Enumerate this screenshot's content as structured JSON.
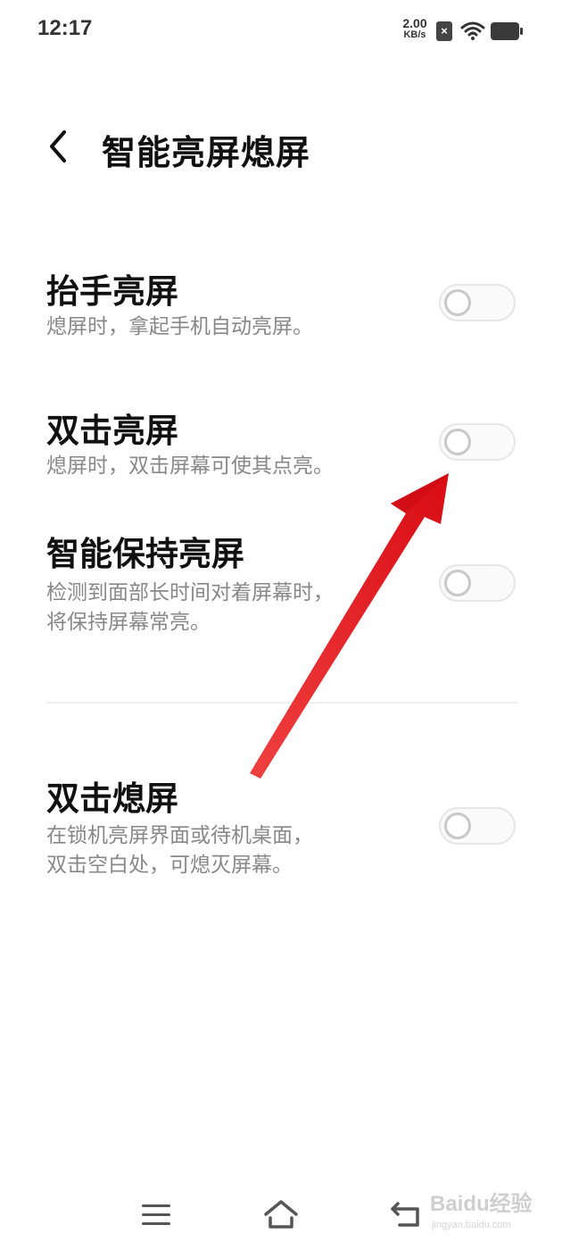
{
  "status_bar": {
    "time": "12:17",
    "net_speed_value": "2.00",
    "net_speed_unit": "KB/s",
    "icons": [
      "sim-off-icon",
      "wifi-icon",
      "battery-icon"
    ]
  },
  "header": {
    "back_icon": "chevron-left-icon",
    "title": "智能亮屏熄屏"
  },
  "settings": [
    {
      "title": "抬手亮屏",
      "desc": "熄屏时，拿起手机自动亮屏。",
      "enabled": false
    },
    {
      "title": "双击亮屏",
      "desc": "熄屏时，双击屏幕可使其点亮。",
      "enabled": false
    },
    {
      "title": "智能保持亮屏",
      "desc_lines": [
        "检测到面部长时间对着屏幕时，",
        "将保持屏幕常亮。"
      ],
      "enabled": false
    },
    {
      "title": "双击熄屏",
      "desc_lines": [
        "在锁机亮屏界面或待机桌面，",
        "双击空白处，可熄灭屏幕。"
      ],
      "enabled": false
    }
  ],
  "nav_bar": {
    "icons": [
      "menu-icon",
      "home-icon",
      "back-icon"
    ]
  },
  "watermark": {
    "text": "Baidu经验",
    "url": "jingyan.baidu.com"
  },
  "colors": {
    "background": "#ffffff",
    "title_text": "#111111",
    "desc_text": "#888888",
    "toggle_off": "#c8c8c8",
    "annotation_arrow": "#e8141b"
  }
}
